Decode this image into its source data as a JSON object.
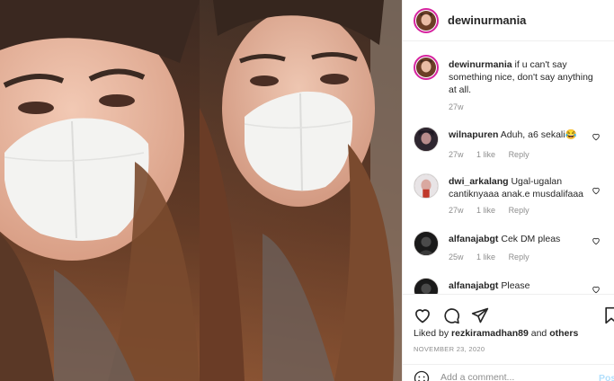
{
  "post": {
    "username": "dewinurmania",
    "caption": "if u can't say something nice, don't say anything at all.",
    "caption_age": "27w",
    "liked_by_prefix": "Liked by ",
    "liked_by_user": "rezkiramadhan89",
    "liked_by_suffix": " and ",
    "liked_by_others": "others",
    "date": "NOVEMBER 23, 2020"
  },
  "comments": [
    {
      "user": "wilnapuren",
      "text": "Aduh, a6 sekali😂",
      "age": "27w",
      "likes": "1 like",
      "reply": "Reply"
    },
    {
      "user": "dwi_arkalang",
      "text": "Ugal-ugalan cantiknyaaa anak.e musdalifaaa",
      "age": "27w",
      "likes": "1 like",
      "reply": "Reply"
    },
    {
      "user": "alfanajabgt",
      "text": "Cek DM pleas",
      "age": "25w",
      "likes": "1 like",
      "reply": "Reply"
    },
    {
      "user": "alfanajabgt",
      "text": "Please",
      "age": "",
      "likes": "",
      "reply": ""
    }
  ],
  "composer": {
    "placeholder": "Add a comment...",
    "post_label": "Pos"
  },
  "colors": {
    "story_ring": "#d6249f",
    "link_blue": "#b2dffc",
    "muted": "#8e8e8e"
  },
  "icons": [
    "heart-icon",
    "comment-icon",
    "share-icon",
    "bookmark-icon",
    "emoji-icon"
  ]
}
